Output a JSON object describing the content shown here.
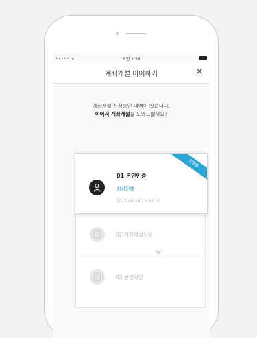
{
  "status_bar": {
    "signal": "••••• ᯤ",
    "time": "오전 1:38"
  },
  "nav": {
    "title": "계좌개설 이어하기",
    "close_glyph": "✕"
  },
  "notice": {
    "line1": "계좌개설 신청중인 내역이 있습니다.",
    "line2_bold": "이어서 계좌개설",
    "line2_rest": "을 도와드릴까요?"
  },
  "steps": {
    "active": {
      "ribbon": "진행중",
      "title": "01 본인인증",
      "status": "심사진행",
      "date": "2017.08.28 13:30:31"
    },
    "step2": {
      "label": "02 계좌개설신청"
    },
    "step3": {
      "label": "03 본인확인"
    }
  },
  "colors": {
    "accent": "#2aa6d6",
    "background": "#f3f3f3",
    "phone_border": "#c9c9c9"
  },
  "icons": [
    "close-icon",
    "user-icon",
    "document-icon",
    "id-card-icon",
    "battery-icon"
  ]
}
